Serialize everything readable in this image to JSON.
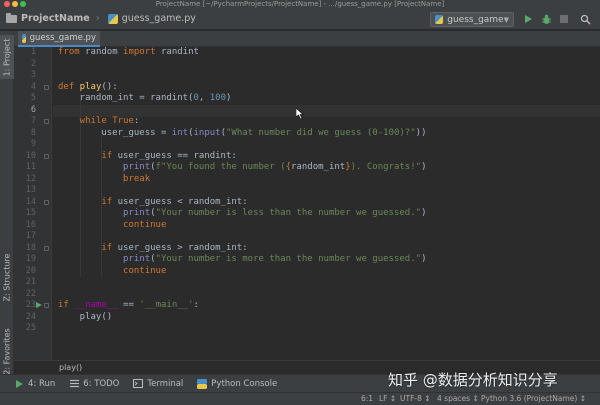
{
  "window": {
    "title": "ProjectName [~/PycharmProjects/ProjectName] - .../guess_game.py [ProjectName]"
  },
  "navbar": {
    "project": "ProjectName",
    "file": "guess_game.py"
  },
  "run_config": {
    "label": "guess_game"
  },
  "tool_strip": {
    "project": "1: Project",
    "structure": "Z: Structure",
    "favorites": "2: Favorites"
  },
  "editor": {
    "tab": "guess_game.py",
    "caret_line": 6,
    "line_numbers": [
      "1",
      "2",
      "3",
      "4",
      "5",
      "6",
      "7",
      "8",
      "9",
      "10",
      "11",
      "12",
      "13",
      "14",
      "15",
      "16",
      "17",
      "18",
      "19",
      "20",
      "21",
      "22",
      "23",
      "24",
      "25"
    ],
    "code": {
      "l1_from": "from",
      "l1_mod": " random ",
      "l1_import": "import",
      "l1_name": " randint",
      "l4_def": "def",
      "l4_fn": " play",
      "l4_rest": "():",
      "l5_a": "    random_int = randint(",
      "l5_n1": "0",
      "l5_b": ", ",
      "l5_n2": "100",
      "l5_c": ")",
      "l7_while": "    while",
      "l7_true": " True",
      "l7_c": ":",
      "l8_a": "        user_guess = ",
      "l8_int": "int",
      "l8_b": "(",
      "l8_input": "input",
      "l8_c": "(",
      "l8_str": "\"What number did we guess (0-100)?\"",
      "l8_d": "))",
      "l10_if": "        if",
      "l10_rest": " user_guess == randint:",
      "l11_print": "            print",
      "l11_a": "(",
      "l11_s1": "f\"You found the number (",
      "l11_b1": "{",
      "l11_var": "random_int",
      "l11_b2": "}",
      "l11_s2": "). Congrats!\"",
      "l11_c": ")",
      "l12_break": "            break",
      "l14_if": "        if",
      "l14_rest": " user_guess < random_int:",
      "l15_print": "            print",
      "l15_a": "(",
      "l15_str": "\"Your number is less than the number we guessed.\"",
      "l15_c": ")",
      "l16_cont": "            continue",
      "l18_if": "        if",
      "l18_rest": " user_guess > random_int:",
      "l19_print": "            print",
      "l19_a": "(",
      "l19_str": "\"Your number is more than the number we guessed.\"",
      "l19_c": ")",
      "l20_cont": "            continue",
      "l23_if": "if",
      "l23_name": " __name__",
      "l23_eq": " == ",
      "l23_str": "'__main__'",
      "l23_c": ":",
      "l24": "    play()"
    },
    "breadcrumb": "play()"
  },
  "tool_windows": [
    {
      "label": "4: Run",
      "icon": "run-icon"
    },
    {
      "label": "6: TODO",
      "icon": "todo-icon"
    },
    {
      "label": "Terminal",
      "icon": "terminal-icon"
    },
    {
      "label": "Python Console",
      "icon": "python-console-icon"
    }
  ],
  "status": {
    "position": "6:1",
    "line_sep": "LF ↕",
    "encoding": "UTF-8 ↕",
    "indent": "4 spaces ↕",
    "interpreter": "Python 3.6 (ProjectName) ↕"
  },
  "watermark": "知乎 @数据分析知识分享",
  "colors": {
    "background": "#2b2b2b",
    "keyword": "#cc7832",
    "function": "#ffc66d",
    "number": "#6897bb",
    "string": "#6a8759",
    "run_green": "#59a869"
  }
}
